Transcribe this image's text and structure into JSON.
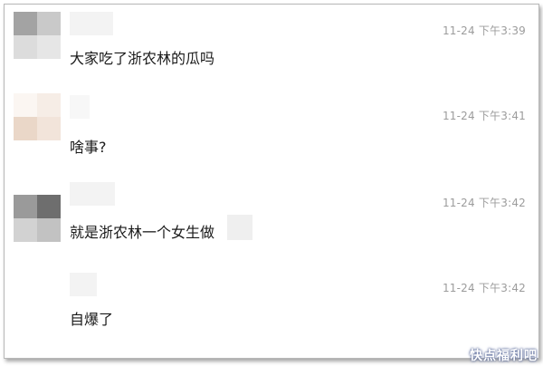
{
  "messages": [
    {
      "timestamp": "11-24 下午3:39",
      "text": "大家吃了浙农林的瓜吗",
      "avatar_colors": [
        "#a3a3a3",
        "#c9c9c9",
        "#dcdcdc",
        "#e6e6e6"
      ]
    },
    {
      "timestamp": "11-24 下午3:41",
      "text": "啥事?",
      "avatar_colors": [
        "#fbf6f2",
        "#f6ede6",
        "#ead7c8",
        "#f2e4da"
      ]
    },
    {
      "timestamp": "11-24 下午3:42",
      "text": "就是浙农林一个女生做",
      "avatar_colors": [
        "#9a9a9a",
        "#6e6e6e",
        "#d2d2d2",
        "#c2c2c2"
      ]
    },
    {
      "timestamp": "11-24 下午3:42",
      "text": "自爆了",
      "avatar_colors": []
    }
  ],
  "watermark": "快点福利吧",
  "colors": {
    "frame_border": "#b8b8b8",
    "timestamp": "#9c9c9c",
    "message_text": "#1a1a1a"
  }
}
